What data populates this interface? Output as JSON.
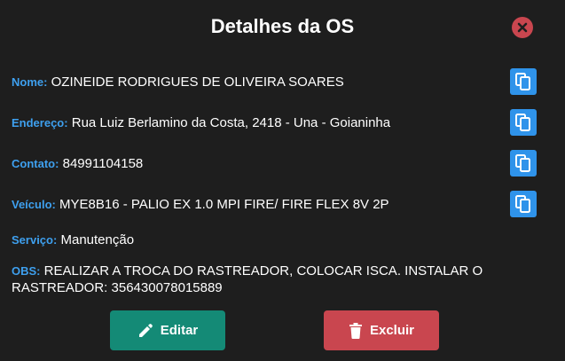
{
  "modal": {
    "title": "Detalhes da OS",
    "close_icon": "close-circle-icon"
  },
  "fields": {
    "nome": {
      "label": "Nome:",
      "value": "OZINEIDE RODRIGUES DE OLIVEIRA SOARES"
    },
    "endereco": {
      "label": "Endereço:",
      "value": "Rua Luiz Berlamino da Costa, 2418 - Una - Goianinha"
    },
    "contato": {
      "label": "Contato:",
      "value": "84991104158"
    },
    "veiculo": {
      "label": "Veículo:",
      "value": "MYE8B16 - PALIO EX 1.0 MPI FIRE/ FIRE FLEX 8V 2P"
    },
    "servico": {
      "label": "Serviço:",
      "value": "Manutenção"
    },
    "obs": {
      "label": "OBS:",
      "value": "REALIZAR A TROCA DO RASTREADOR, COLOCAR ISCA. INSTALAR O RASTREADOR: 356430078015889"
    }
  },
  "actions": {
    "edit_label": "Editar",
    "delete_label": "Excluir"
  },
  "colors": {
    "background": "#1e1e1e",
    "label": "#3ea0ef",
    "copy_button": "#2f93ea",
    "edit_button": "#148a76",
    "delete_button": "#c9464f"
  }
}
